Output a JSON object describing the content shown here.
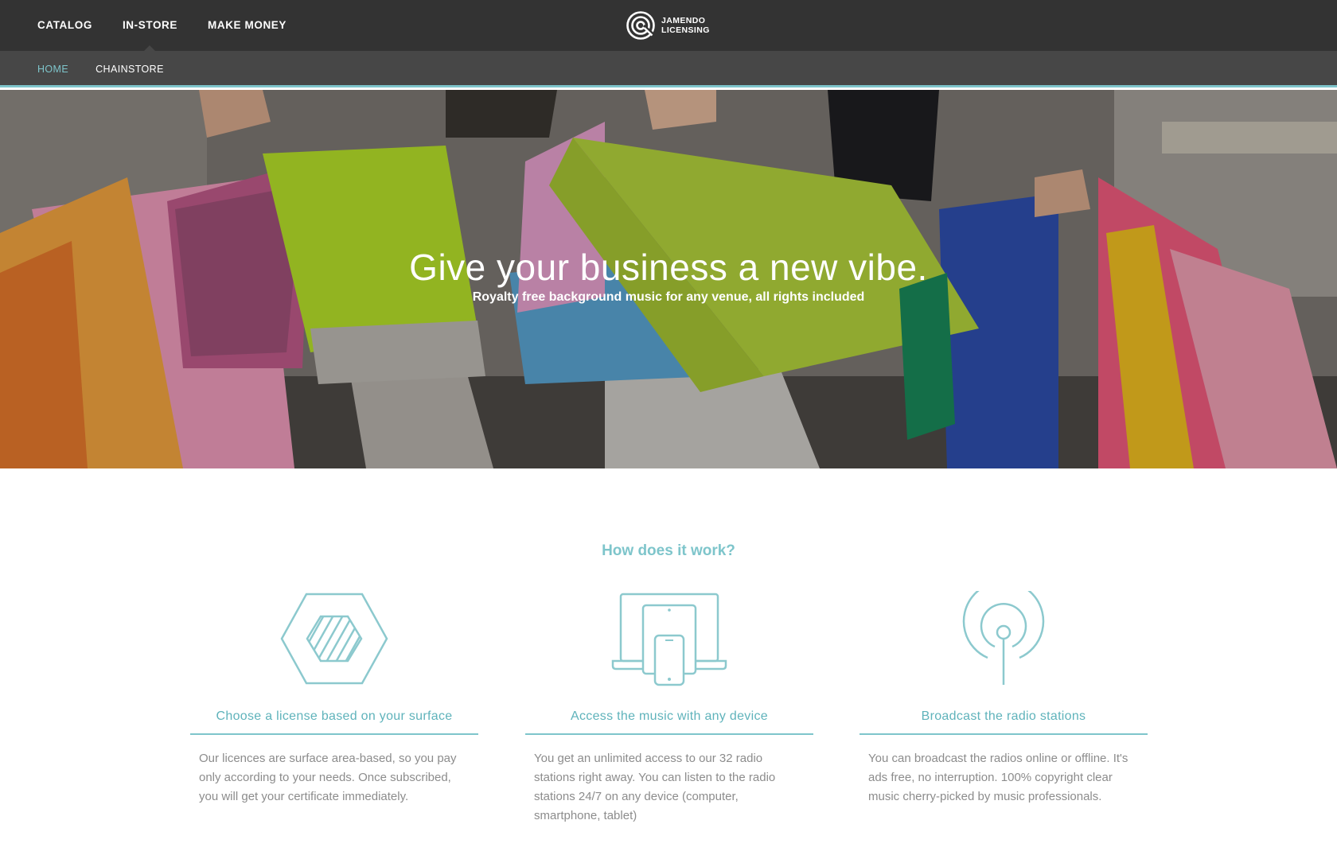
{
  "main_nav": {
    "items": [
      {
        "label": "CATALOG",
        "active": false
      },
      {
        "label": "IN-STORE",
        "active": true
      },
      {
        "label": "MAKE MONEY",
        "active": false
      }
    ]
  },
  "brand": {
    "line1": "JAMENDO",
    "line2": "LICENSING",
    "icon": "jamendo-logo-icon"
  },
  "sub_nav": {
    "items": [
      {
        "label": "HOME",
        "active": true
      },
      {
        "label": "CHAINSTORE",
        "active": false
      }
    ]
  },
  "hero": {
    "title": "Give your business a new vibe.",
    "subtitle": "Royalty free background music for any venue, all rights included"
  },
  "how": {
    "title": "How does it work?",
    "features": [
      {
        "icon": "hexagon-surface-icon",
        "title": "Choose a license based on your surface",
        "text": "Our licences are surface area-based, so you pay only according to your needs. Once subscribed, you will get your certificate immediately."
      },
      {
        "icon": "devices-icon",
        "title": "Access the music with any device",
        "text": "You get an unlimited access to our 32 radio stations right away. You can listen to the radio stations 24/7 on any device (computer, smartphone, tablet)"
      },
      {
        "icon": "radio-broadcast-icon",
        "title": "Broadcast the radio stations",
        "text": "You can broadcast the radios online or offline. It's ads free, no interruption. 100% copyright clear music cherry-picked by music professionals."
      }
    ]
  },
  "colors": {
    "accent": "#7ec5cb",
    "topbar": "#333333",
    "subbar": "#474747"
  }
}
